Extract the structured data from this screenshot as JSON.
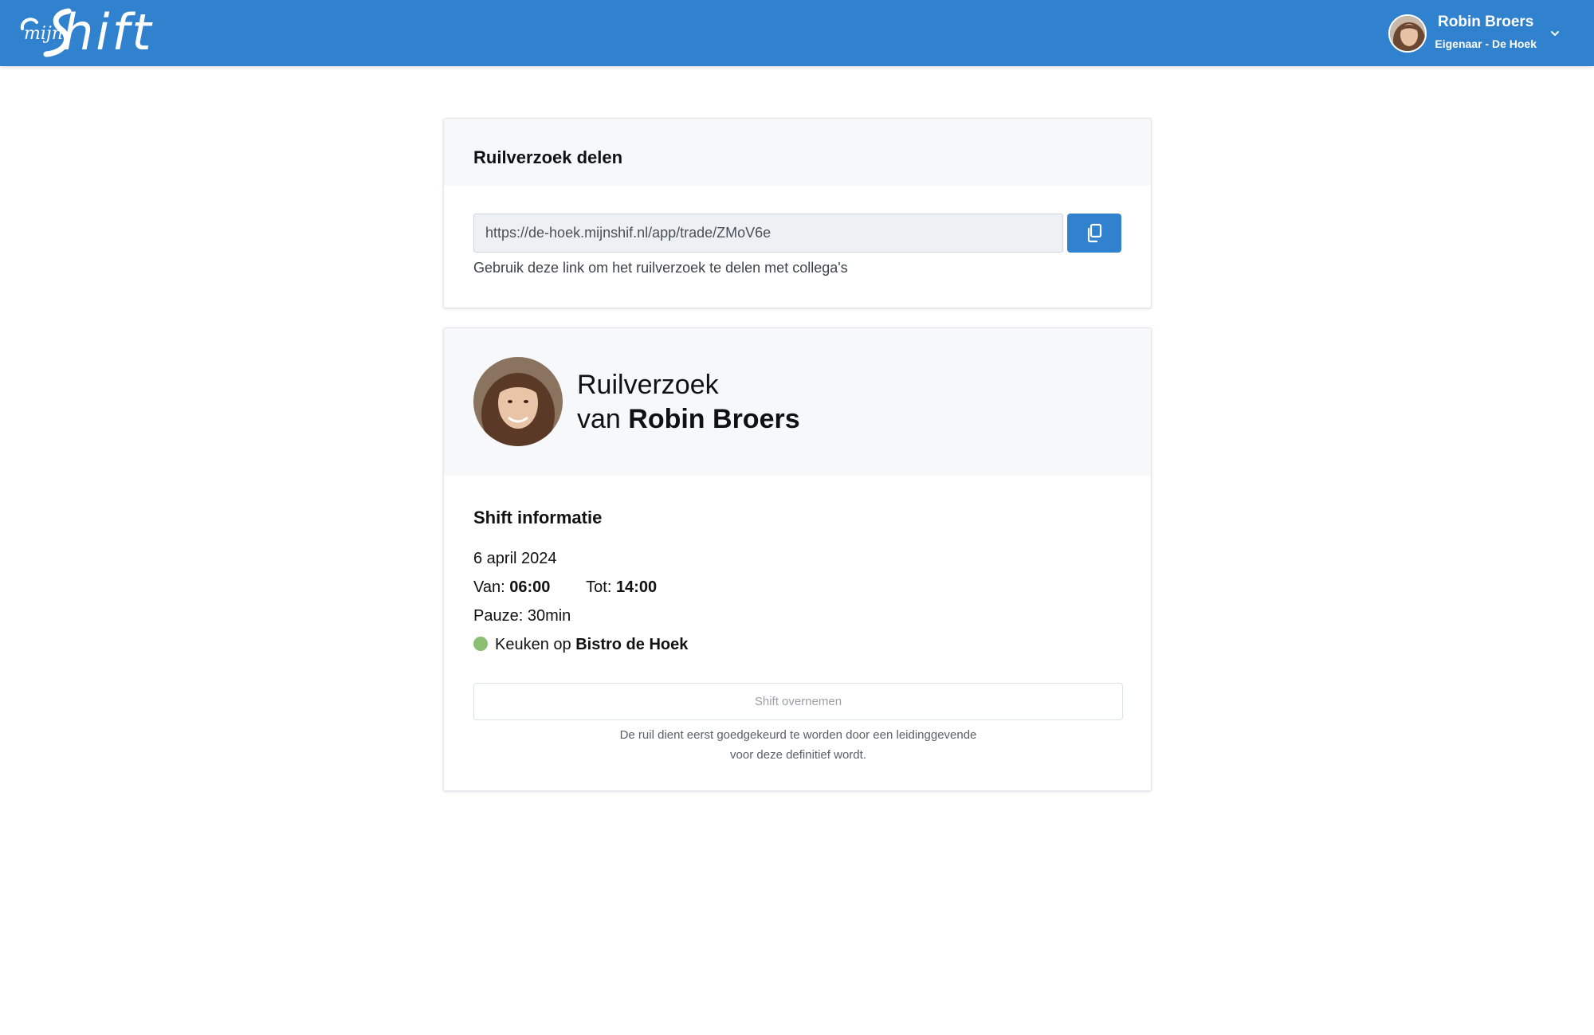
{
  "header": {
    "logo_small": "mijn",
    "logo_large": "hift",
    "user_name": "Robin Broers",
    "user_role": "Eigenaar - De Hoek"
  },
  "share_card": {
    "title": "Ruilverzoek delen",
    "link_value": "https://de-hoek.mijnshif.nl/app/trade/ZMoV6e",
    "help_text": "Gebruik deze link om het ruilverzoek te delen met collega's"
  },
  "request_card": {
    "title_line1": "Ruilverzoek",
    "title_prefix": "van ",
    "requester": "Robin Broers",
    "section_title": "Shift informatie",
    "date": "6 april 2024",
    "from_label": "Van: ",
    "from_time": "06:00",
    "to_label": "Tot: ",
    "to_time": "14:00",
    "pause": "Pauze: 30min",
    "department": "Keuken",
    "location_joiner": " op ",
    "location": "Bistro de Hoek",
    "take_button": "Shift overnemen",
    "note_line1": "De ruil dient eerst goedgekeurd te worden door een leidinggevende",
    "note_line2": "voor deze definitief wordt."
  },
  "colors": {
    "primary": "#3182ce",
    "department_dot": "#8bbf72",
    "card_header_bg": "#f7f8fa"
  },
  "icons": {
    "copy": "copy-icon",
    "chevron": "chevron-down-icon"
  }
}
